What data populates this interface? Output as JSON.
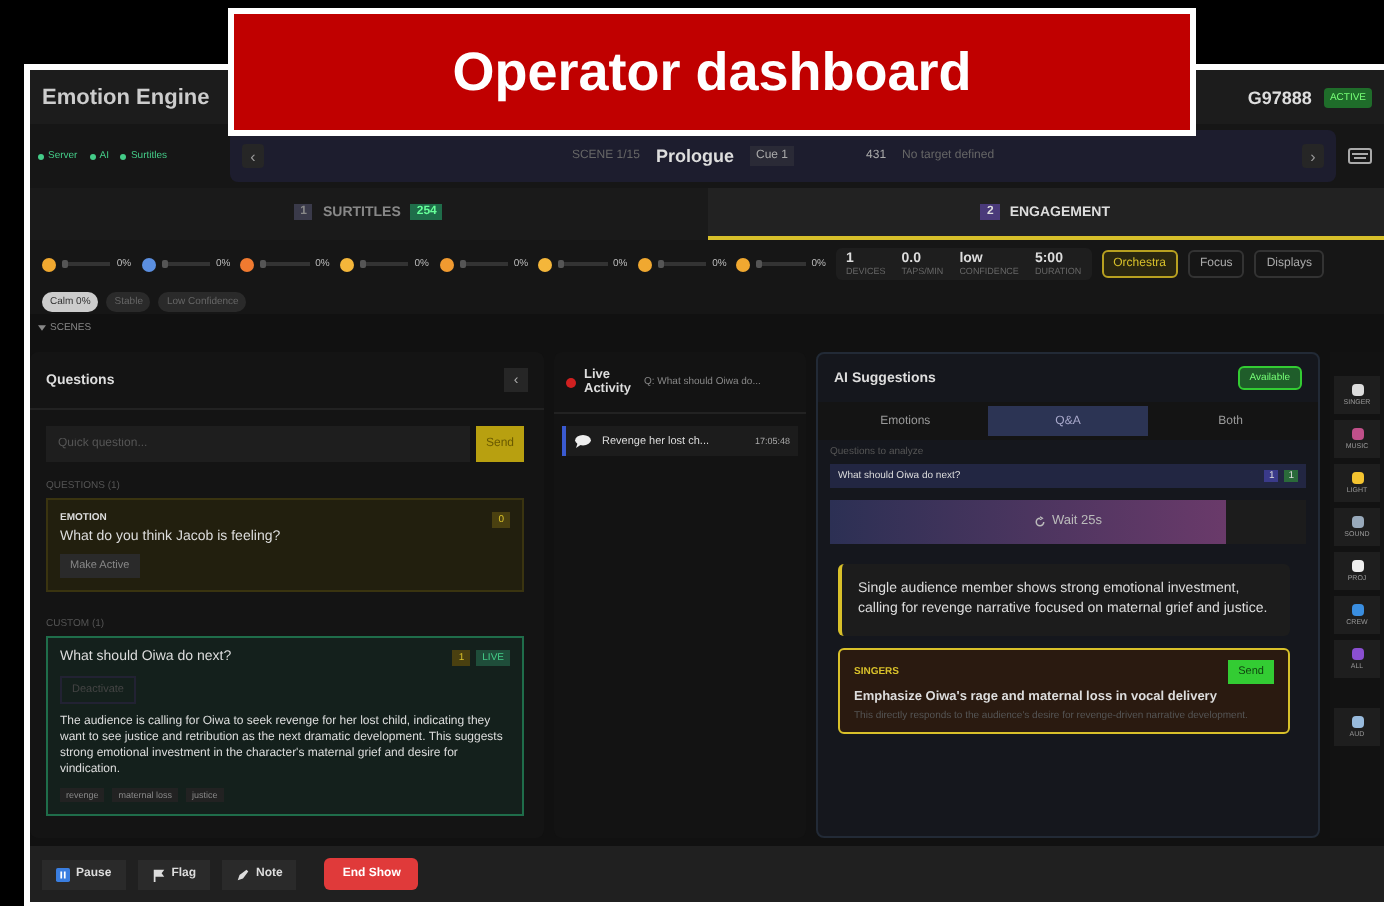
{
  "banner": {
    "title": "Operator dashboard"
  },
  "header": {
    "app_name": "Emotion Engine",
    "code": "G97888",
    "status": "ACTIVE"
  },
  "status_pills": [
    {
      "label": "Server"
    },
    {
      "label": "AI"
    },
    {
      "label": "Surtitles"
    }
  ],
  "scene_bar": {
    "prev": "‹",
    "scene_label": "SCENE 1/15",
    "scene_name": "Prologue",
    "cue": "Cue 1",
    "number": "431",
    "target": "No target defined",
    "next": "›"
  },
  "tabs": [
    {
      "number": "1",
      "label": "SURTITLES",
      "count": "254",
      "selected": false
    },
    {
      "number": "2",
      "label": "ENGAGEMENT",
      "selected": true
    }
  ],
  "emotions": [
    {
      "color": "#f0a830",
      "level": 0,
      "reading": "0%"
    },
    {
      "color": "#5b8fe0",
      "level": 0,
      "reading": "0%"
    },
    {
      "color": "#f07a30",
      "level": 0,
      "reading": "0%"
    },
    {
      "color": "#f4b63a",
      "level": 0,
      "reading": "0%"
    },
    {
      "color": "#f09a30",
      "level": 0,
      "reading": "0%"
    },
    {
      "color": "#f4b63a",
      "level": 0,
      "reading": "0%"
    },
    {
      "color": "#f0a830",
      "level": 0,
      "reading": "0%"
    },
    {
      "color": "#f0a830",
      "level": 0,
      "reading": "0%"
    }
  ],
  "stats": [
    {
      "value": "1",
      "label": "DEVICES"
    },
    {
      "value": "0.0",
      "label": "TAPS/MIN"
    },
    {
      "value": "low",
      "label": "CONFIDENCE"
    },
    {
      "value": "5:00",
      "label": "DURATION"
    }
  ],
  "modes": [
    {
      "label": "Orchestra",
      "selected": true
    },
    {
      "label": "Focus",
      "selected": false
    },
    {
      "label": "Displays",
      "selected": false
    }
  ],
  "chips": [
    {
      "label": "Calm 0%",
      "selected": true
    },
    {
      "label": "Stable",
      "selected": false
    },
    {
      "label": "Low Confidence",
      "selected": false
    }
  ],
  "scenes_toggle": {
    "label": "SCENES",
    "expanded": false
  },
  "questions": {
    "title": "Questions",
    "collapse": "‹",
    "placeholder": "Quick question...",
    "send": "Send",
    "groups": [
      {
        "heading": "QUESTIONS (1)",
        "items": [
          {
            "category": "EMOTION",
            "text": "What do you think Jacob is feeling?",
            "count": "0",
            "action": "Make Active",
            "live": false
          }
        ]
      },
      {
        "heading": "CUSTOM (1)",
        "items": [
          {
            "text": "What should Oiwa do next?",
            "count": "1",
            "badge": "LIVE",
            "action": "Deactivate",
            "live": true,
            "summary": "The audience is calling for Oiwa to seek revenge for her lost child, indicating they want to see justice and retribution as the next dramatic development. This suggests strong emotional investment in the character's maternal grief and desire for vindication.",
            "tags": [
              "revenge",
              "maternal loss",
              "justice"
            ]
          }
        ]
      }
    ]
  },
  "live_activity": {
    "title": "Live Activity",
    "question": "Q: What should Oiwa do...",
    "items": [
      {
        "text": "Revenge her lost ch...",
        "time": "17:05:48"
      }
    ]
  },
  "ai": {
    "title": "AI Suggestions",
    "status": "Available",
    "tabs": [
      {
        "label": "Emotions",
        "selected": false
      },
      {
        "label": "Q&A",
        "selected": true
      },
      {
        "label": "Both",
        "selected": false
      }
    ],
    "analyze_label": "Questions to analyze",
    "question": {
      "text": "What should Oiwa do next?",
      "count": "1",
      "votes": "1"
    },
    "wait": {
      "label": "Wait 25s",
      "level": 0.83
    },
    "summary": "Single audience member shows strong emotional investment, calling for revenge narrative focused on maternal grief and justice.",
    "suggestions": [
      {
        "target": "SINGERS",
        "action": "Send",
        "title": "Emphasize Oiwa's rage and maternal loss in vocal delivery",
        "detail": "This directly responds to the audience's desire for revenge-driven narrative development."
      }
    ]
  },
  "toolbar": [
    {
      "label": "SINGER"
    },
    {
      "label": "MUSIC"
    },
    {
      "label": "LIGHT"
    },
    {
      "label": "SOUND"
    },
    {
      "label": "PROJ"
    },
    {
      "label": "CREW"
    },
    {
      "label": "ALL"
    },
    {
      "label": "AUD"
    }
  ],
  "footer": [
    {
      "label": "Pause",
      "kind": "pause"
    },
    {
      "label": "Flag",
      "kind": "flag"
    },
    {
      "label": "Note",
      "kind": "note"
    },
    {
      "label": "End Show",
      "kind": "danger"
    }
  ]
}
